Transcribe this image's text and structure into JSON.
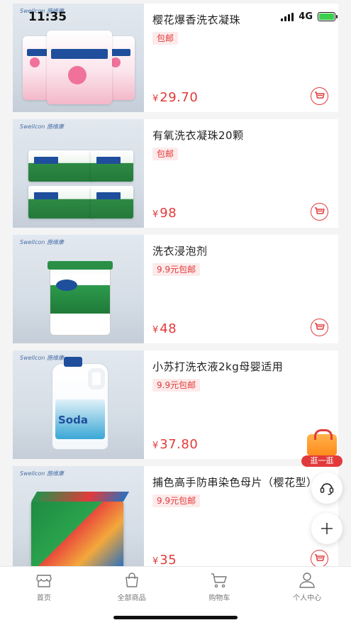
{
  "status_bar": {
    "time": "11:35",
    "network": "4G"
  },
  "products": [
    {
      "title": "樱花爆香洗衣凝珠",
      "tag": "包邮",
      "currency": "¥",
      "price": "29.70",
      "brand": "Swellcon 施维康"
    },
    {
      "title": "有氧洗衣凝珠20颗",
      "tag": "包邮",
      "currency": "¥",
      "price": "98",
      "brand": "Swellcon 施维康"
    },
    {
      "title": "洗衣浸泡剂",
      "tag": "9.9元包邮",
      "currency": "¥",
      "price": "48",
      "brand": "Swellcon 施维康"
    },
    {
      "title": "小苏打洗衣液2kg母婴适用",
      "tag": "9.9元包邮",
      "currency": "¥",
      "price": "37.80",
      "brand": "Swellcon 施维康",
      "bottle_text": "Soda"
    },
    {
      "title": "捕色高手防串染色母片（樱花型）",
      "tag": "9.9元包邮",
      "currency": "¥",
      "price": "35",
      "brand": "Swellcon 施维康"
    }
  ],
  "floating": {
    "shop_label": "逛一逛",
    "icons": [
      "headset-icon",
      "plus-icon"
    ]
  },
  "tabbar": {
    "tabs": [
      {
        "label": "首页",
        "icon": "store-icon"
      },
      {
        "label": "全部商品",
        "icon": "bag-icon"
      },
      {
        "label": "购物车",
        "icon": "cart-icon"
      },
      {
        "label": "个人中心",
        "icon": "user-icon"
      }
    ]
  },
  "colors": {
    "accent": "#e23a3a",
    "tag_bg": "#fdeaea",
    "tab_text": "#777777"
  }
}
